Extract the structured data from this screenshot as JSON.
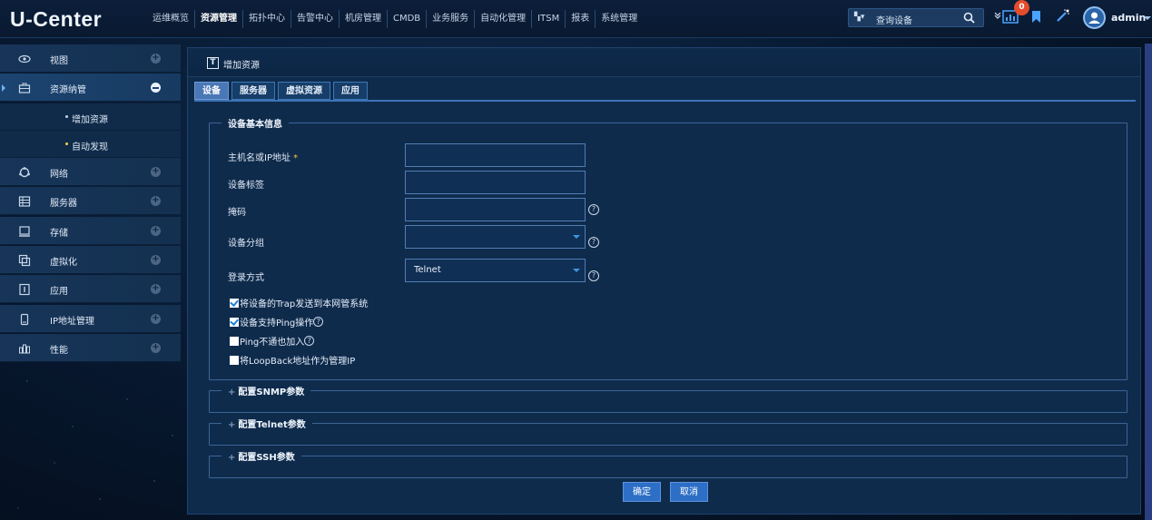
{
  "app": {
    "logo": "U-Center"
  },
  "nav": {
    "items": [
      "运维概览",
      "资源管理",
      "拓扑中心",
      "告警中心",
      "机房管理",
      "CMDB",
      "业务服务",
      "自动化管理",
      "ITSM",
      "报表",
      "系统管理"
    ],
    "active": "资源管理"
  },
  "search": {
    "placeholder": "查询设备",
    "icon": "search-icon"
  },
  "top": {
    "badge_count": "0",
    "username": "admin"
  },
  "sidebar": {
    "items": [
      {
        "label": "视图",
        "icon": "eye-icon"
      },
      {
        "label": "资源纳管",
        "icon": "briefcase-icon"
      },
      {
        "label": "网络",
        "icon": "network-icon"
      },
      {
        "label": "服务器",
        "icon": "server-icon"
      },
      {
        "label": "存储",
        "icon": "storage-icon"
      },
      {
        "label": "虚拟化",
        "icon": "virtualization-icon"
      },
      {
        "label": "应用",
        "icon": "app-icon"
      },
      {
        "label": "IP地址管理",
        "icon": "ip-icon"
      },
      {
        "label": "性能",
        "icon": "performance-icon"
      }
    ],
    "subitems": [
      "增加资源",
      "自动发现"
    ]
  },
  "panel": {
    "title_icon": "T",
    "title": "增加资源",
    "tabs": [
      "设备",
      "服务器",
      "虚拟资源",
      "应用"
    ],
    "basic_section": "设备基本信息",
    "fields": {
      "host_label": "主机名或IP地址",
      "required_mark": "*",
      "tag_label": "设备标签",
      "mask_label": "掩码",
      "group_label": "设备分组",
      "login_label": "登录方式",
      "login_value": "Telnet"
    },
    "checkboxes": [
      {
        "label": "将设备的Trap发送到本网管系统",
        "checked": true,
        "help": false
      },
      {
        "label": "设备支持Ping操作",
        "checked": true,
        "help": true
      },
      {
        "label": "Ping不通也加入",
        "checked": false,
        "help": true
      },
      {
        "label": "将LoopBack地址作为管理IP",
        "checked": false,
        "help": false
      }
    ],
    "sections": [
      "配置SNMP参数",
      "配置Telnet参数",
      "配置SSH参数"
    ],
    "help_glyph": "?",
    "buttons": {
      "ok": "确定",
      "cancel": "取消"
    }
  }
}
